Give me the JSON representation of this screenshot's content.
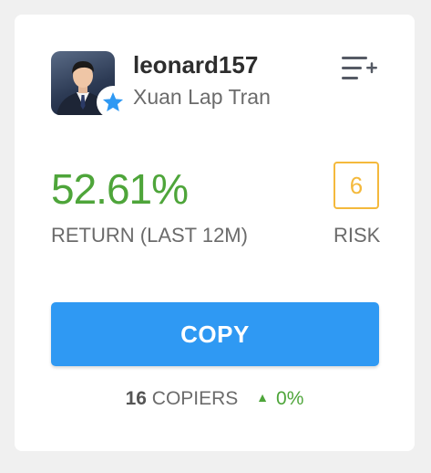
{
  "trader": {
    "username": "leonard157",
    "full_name": "Xuan Lap Tran"
  },
  "stats": {
    "return_value": "52.61%",
    "return_label": "RETURN (LAST 12M)",
    "risk_score": "6",
    "risk_label": "RISK"
  },
  "actions": {
    "copy_label": "COPY"
  },
  "copiers": {
    "count": "16",
    "label": "COPIERS",
    "change": "0%"
  },
  "colors": {
    "return_green": "#4ea53a",
    "risk_orange": "#f4b93c",
    "copy_blue": "#2f99f3",
    "star_blue": "#2f99f3"
  },
  "icons": {
    "star_badge": "star-icon",
    "watchlist": "add-to-watchlist-icon",
    "trend": "triangle-up-icon"
  }
}
